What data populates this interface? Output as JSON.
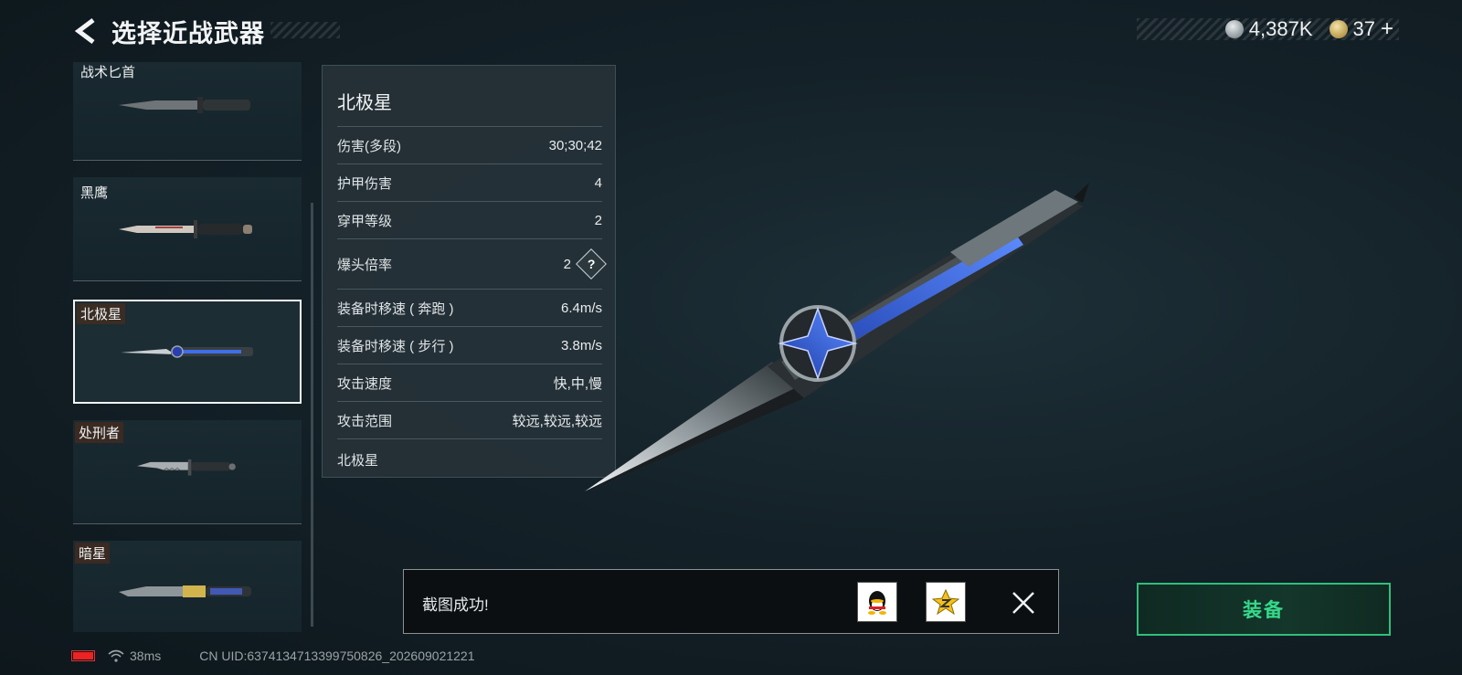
{
  "header": {
    "title": "选择近战武器"
  },
  "currency": {
    "silver_value": "4,387K",
    "gold_value": "37",
    "plus": "+"
  },
  "weapons": [
    {
      "name": "战术匕首"
    },
    {
      "name": "黑鹰"
    },
    {
      "name": "北极星",
      "selected": true
    },
    {
      "name": "处刑者"
    },
    {
      "name": "暗星"
    }
  ],
  "details": {
    "title": "北极星",
    "stats": [
      {
        "label": "伤害(多段)",
        "value": "30;30;42"
      },
      {
        "label": "护甲伤害",
        "value": "4"
      },
      {
        "label": "穿甲等级",
        "value": "2"
      },
      {
        "label": "爆头倍率",
        "value": "2",
        "help": "?"
      },
      {
        "label": "装备时移速 ( 奔跑 )",
        "value": "6.4m/s"
      },
      {
        "label": "装备时移速 ( 步行 )",
        "value": "3.8m/s"
      },
      {
        "label": "攻击速度",
        "value": "快,中,慢"
      },
      {
        "label": "攻击范围",
        "value": "较远,较远,较远"
      }
    ],
    "footer": "北极星"
  },
  "toast": {
    "text": "截图成功!"
  },
  "equip": {
    "label": "装备"
  },
  "status": {
    "ping": "38ms",
    "uid": "CN UID:6374134713399750826_202609021221"
  },
  "colors": {
    "accent_green": "#36d98a",
    "selected_border": "#f4f6f7",
    "battery_red": "#e22222"
  },
  "icons": [
    "back-arrow-icon",
    "silver-coin-icon",
    "gold-coin-icon",
    "help-icon",
    "qq-icon",
    "qzone-icon",
    "close-icon",
    "battery-icon",
    "wifi-icon"
  ]
}
